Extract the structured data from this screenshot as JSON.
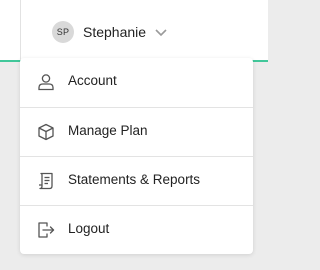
{
  "header": {
    "user": {
      "initials": "SP",
      "name": "Stephanie"
    }
  },
  "menu": {
    "items": [
      {
        "label": "Account",
        "icon": "user-icon"
      },
      {
        "label": "Manage Plan",
        "icon": "box-icon"
      },
      {
        "label": "Statements & Reports",
        "icon": "document-icon"
      },
      {
        "label": "Logout",
        "icon": "logout-icon"
      }
    ]
  },
  "colors": {
    "accent": "#41c79a",
    "icon": "#555555",
    "text": "#222222"
  }
}
